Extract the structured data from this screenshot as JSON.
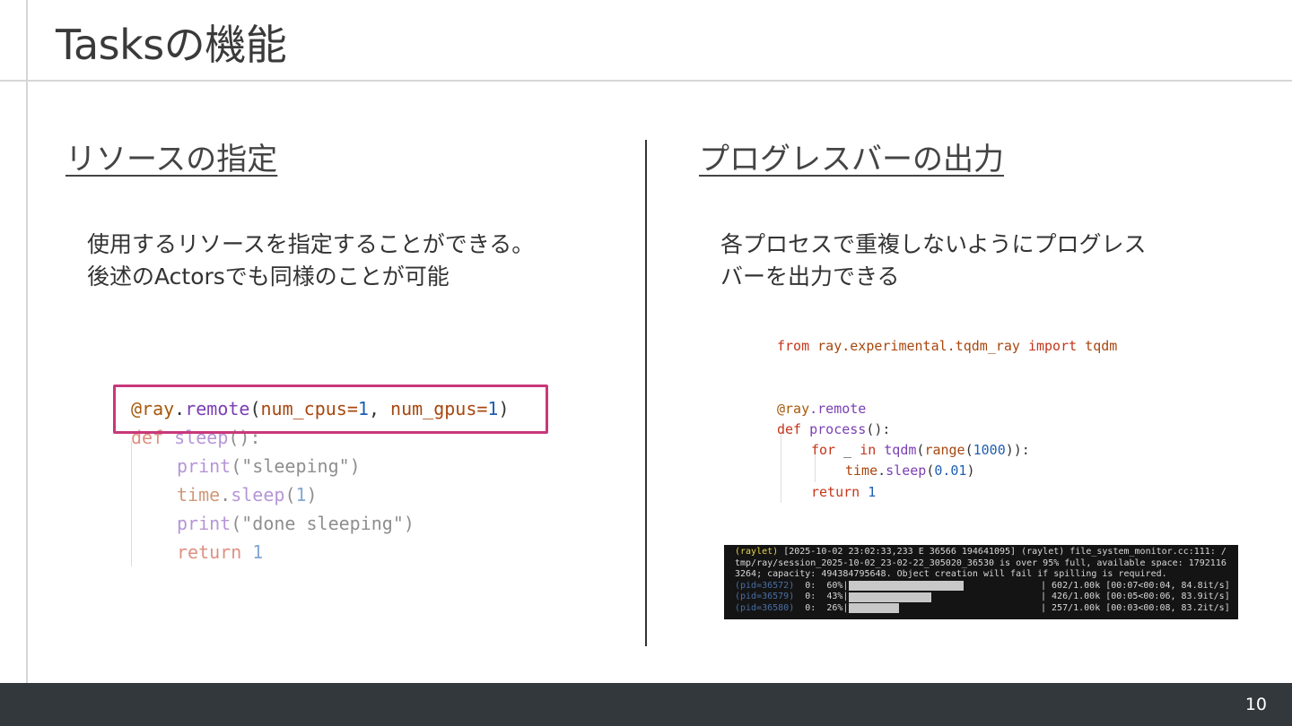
{
  "slide": {
    "title": "Tasksの機能",
    "page_number": "10"
  },
  "left": {
    "heading": "リソースの指定",
    "desc_line1": "使用するリソースを指定することができる。",
    "desc_line2": "後述のActorsでも同様のことが可能",
    "code": {
      "l1_decorator": "@ray",
      "l1_dot": ".",
      "l1_fn": "remote",
      "l1_open": "(",
      "l1_p1": "num_cpus=",
      "l1_v1": "1",
      "l1_comma": ", ",
      "l1_p2": "num_gpus=",
      "l1_v2": "1",
      "l1_close": ")",
      "l2_kw": "def",
      "l2_fn": " sleep",
      "l2_rest": "():",
      "l3_fn": "print",
      "l3_str": "(\"sleeping\")",
      "l4_obj": "time",
      "l4_dot": ".",
      "l4_fn": "sleep",
      "l4_open": "(",
      "l4_num": "1",
      "l4_close": ")",
      "l5_fn": "print",
      "l5_str": "(\"done sleeping\")",
      "l6_kw": "return",
      "l6_num": " 1"
    }
  },
  "right": {
    "heading": "プログレスバーの出力",
    "desc_line1": "各プロセスで重複しないようにプログレス",
    "desc_line2": "バーを出力できる",
    "code": {
      "r1_kw": "from",
      "r1_mod": " ray.experimental.tqdm_ray ",
      "r1_kw2": "import",
      "r1_name": " tqdm",
      "r2_dec": "@ray",
      "r2_rest": ".remote",
      "r3_kw": "def",
      "r3_fn": " process",
      "r3_rest": "():",
      "r4_kw": "for",
      "r4_mid": " _ ",
      "r4_kw2": "in",
      "r4_fn": " tqdm",
      "r4_open": "(",
      "r4_range": "range",
      "r4_open2": "(",
      "r4_num": "1000",
      "r4_close": ")):",
      "r5_obj": "time",
      "r5_dot": ".",
      "r5_fn": "sleep",
      "r5_open": "(",
      "r5_num": "0.01",
      "r5_close": ")",
      "r6_kw": "return",
      "r6_num": " 1"
    },
    "terminal": {
      "line1_prefix": "(raylet)",
      "line1_rest": " [2025-10-02 23:02:33,233 E 36566 194641095] (raylet) file_system_monitor.cc:111: /",
      "line2": "tmp/ray/session_2025-10-02_23-02-22_305020_36530 is over 95% full, available space: 1792116",
      "line3": "3264; capacity: 494384795648. Object creation will fail if spilling is required.",
      "rows": [
        {
          "pid": "(pid=36572)",
          "idx": "0:",
          "pct": "60%|",
          "progress": 0.6,
          "stats": "| 602/1.00k [00:07<00:04, 84.8it/s]"
        },
        {
          "pid": "(pid=36579)",
          "idx": "0:",
          "pct": "43%|",
          "progress": 0.43,
          "stats": "| 426/1.00k [00:05<00:06, 83.9it/s]"
        },
        {
          "pid": "(pid=36580)",
          "idx": "0:",
          "pct": "26%|",
          "progress": 0.26,
          "stats": "| 257/1.00k [00:03<00:08, 83.2it/s]"
        }
      ]
    }
  }
}
